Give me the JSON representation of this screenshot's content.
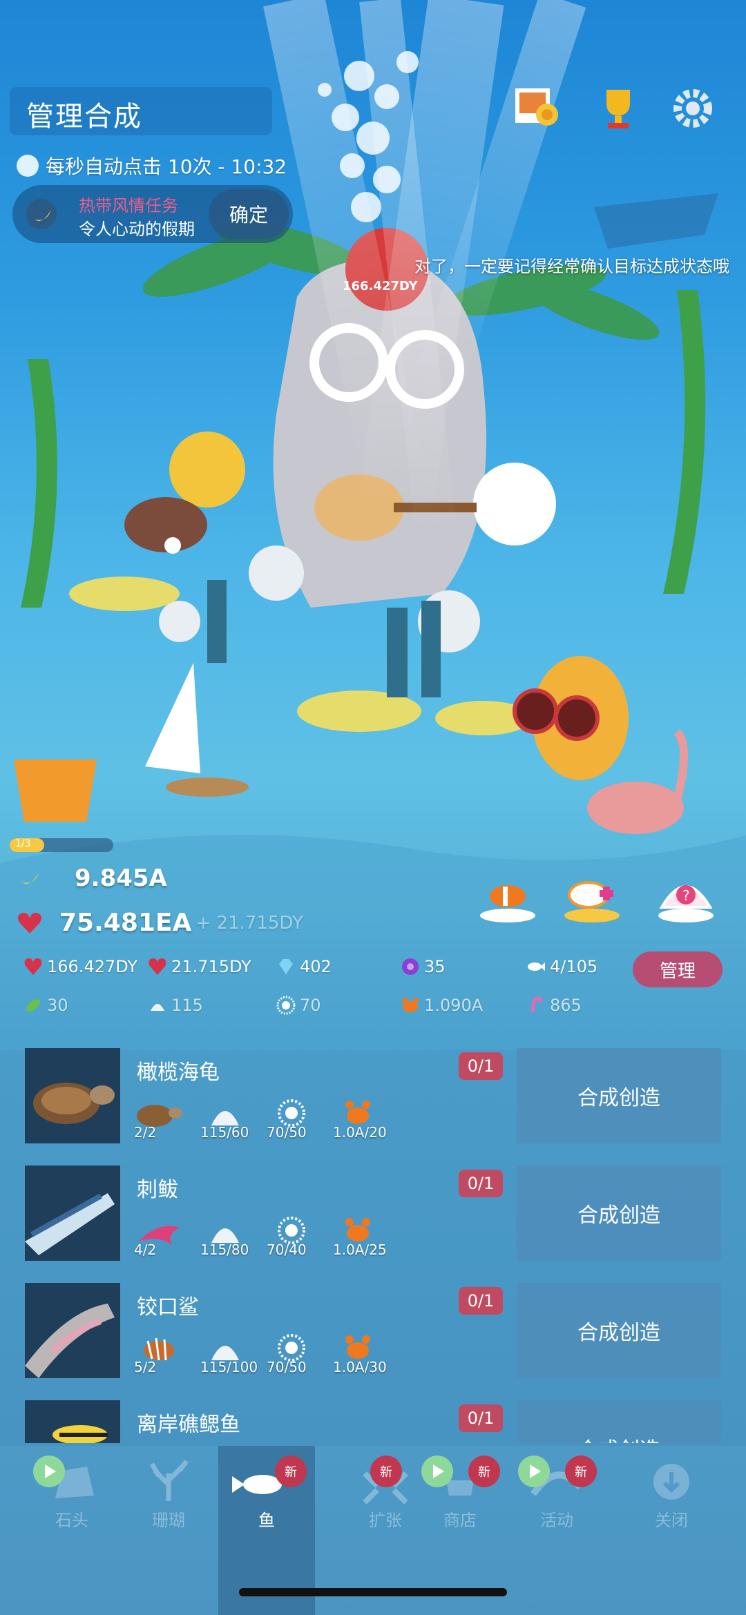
{
  "header": {
    "title": "管理合成"
  },
  "auto_click": {
    "text": "每秒自动点击 10次 - 10:32"
  },
  "task": {
    "category": "热带风情任务",
    "name": "令人心动的假期",
    "confirm_label": "确定"
  },
  "tip": "对了，一定要记得经常确认目标达成状态哦",
  "bubble_value": "166.427DY",
  "level_progress": {
    "text": "1/3",
    "fraction": 0.33
  },
  "currency": {
    "banana": "9.845A",
    "heart": "75.481EA",
    "heart_rate": "+ 21.715DY"
  },
  "stats": {
    "tap_heart": "166.427DY",
    "auto_heart": "21.715DY",
    "gems": "402",
    "pearls": "35",
    "fish_count": "4/105",
    "manage_label": "管理",
    "seaweed": "30",
    "shell": "115",
    "urchin": "70",
    "crab": "1.090A",
    "flamingo": "865"
  },
  "recipes": [
    {
      "name": "橄榄海龟",
      "count": "0/1",
      "button": "合成创造",
      "reqs": [
        "2/2",
        "115/60",
        "70/50",
        "1.0A/20"
      ]
    },
    {
      "name": "刺鲅",
      "count": "0/1",
      "button": "合成创造",
      "reqs": [
        "4/2",
        "115/80",
        "70/40",
        "1.0A/25"
      ]
    },
    {
      "name": "铰口鲨",
      "count": "0/1",
      "button": "合成创造",
      "reqs": [
        "5/2",
        "115/100",
        "70/50",
        "1.0A/30"
      ]
    },
    {
      "name": "离岸礁鳃鱼",
      "count": "0/1",
      "button": "合成创造",
      "reqs": []
    }
  ],
  "nav": {
    "stone": "石头",
    "coral": "珊瑚",
    "fish": "鱼",
    "expand": "扩张",
    "shop": "商店",
    "event": "活动",
    "close": "关闭",
    "badge": "新"
  },
  "colors": {
    "accent_pink": "#b84d73",
    "badge_red": "#c0374f",
    "button_blue": "#508cb9"
  }
}
